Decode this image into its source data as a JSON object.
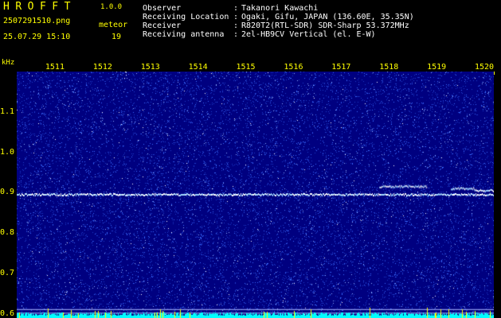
{
  "app": {
    "logo": "HROFFT",
    "version": "1.0.0"
  },
  "file": {
    "name": "2507291510.png",
    "datetime": "25.07.29 15:10"
  },
  "meteor": {
    "label": "meteor",
    "count": "19"
  },
  "info": [
    {
      "key": "Observer",
      "value": "Takanori Kawachi"
    },
    {
      "key": "Receiving Location",
      "value": "Ogaki, Gifu, JAPAN (136.60E, 35.35N)"
    },
    {
      "key": "Receiver",
      "value": "R820T2(RTL-SDR) SDR-Sharp 53.372MHz"
    },
    {
      "key": "Receiving antenna",
      "value": "2el-HB9CV Vertical (el. E-W)"
    }
  ],
  "colors": {
    "label": "#ffff00",
    "background": "#000080",
    "signal": "#ffffff",
    "noise": "#3a6cff",
    "level": "#00ffff"
  },
  "chart_data": {
    "type": "heatmap",
    "y_unit": "kHz",
    "x_ticks": [
      "1511",
      "1512",
      "1513",
      "1514",
      "1515",
      "1516",
      "1517",
      "1518",
      "1519",
      "1520"
    ],
    "y_ticks": [
      "1.1",
      "1.0",
      "0.9",
      "0.8",
      "0.7",
      "0.6"
    ],
    "x_range": [
      1510,
      1520
    ],
    "y_range": [
      0.59,
      1.2
    ],
    "signals": [
      {
        "x_start": 1510,
        "x_end": 1520,
        "freq": 0.895
      },
      {
        "x_start": 1517.6,
        "x_end": 1518.6,
        "freq": 0.915
      },
      {
        "x_start": 1519.1,
        "x_end": 1519.6,
        "freq": 0.91
      },
      {
        "x_start": 1519.6,
        "x_end": 1520,
        "freq": 0.905
      }
    ]
  }
}
